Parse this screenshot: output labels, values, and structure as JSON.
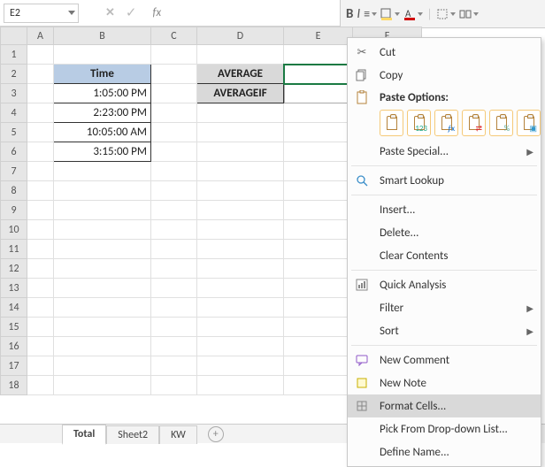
{
  "namebox": {
    "value": "E2"
  },
  "formula_bar": {
    "fx_label": "fx"
  },
  "ribbon": {
    "bold": "B",
    "italic": "I"
  },
  "columns": [
    "A",
    "B",
    "C",
    "D",
    "E",
    "F"
  ],
  "rows": [
    "1",
    "2",
    "3",
    "4",
    "5",
    "6",
    "7",
    "8",
    "9",
    "10",
    "11",
    "12",
    "13",
    "14",
    "15",
    "16",
    "17",
    "18"
  ],
  "cells": {
    "B2": "Time",
    "B3": "1:05:00 PM",
    "B4": "2:23:00 PM",
    "B5": "10:05:00 AM",
    "B6": "3:15:00 PM",
    "D2": "AVERAGE",
    "D3": "AVERAGEIF"
  },
  "sheet_tabs": {
    "active": "Total",
    "others": [
      "Sheet2",
      "KW"
    ]
  },
  "context_menu": {
    "cut": "Cut",
    "copy": "Copy",
    "paste_options_hdr": "Paste Options:",
    "paste_special": "Paste Special...",
    "smart_lookup": "Smart Lookup",
    "insert": "Insert...",
    "delete": "Delete...",
    "clear": "Clear Contents",
    "quick_analysis": "Quick Analysis",
    "filter": "Filter",
    "sort": "Sort",
    "new_comment": "New Comment",
    "new_note": "New Note",
    "format_cells": "Format Cells...",
    "pick_list": "Pick From Drop-down List...",
    "define_name": "Define Name..."
  }
}
